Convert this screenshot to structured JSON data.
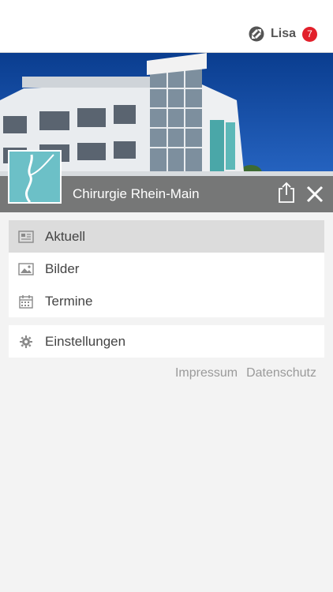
{
  "header": {
    "user_name": "Lisa",
    "notification_count": "7",
    "brand_color": "#e2202b"
  },
  "hero": {
    "title": "Chirurgie Rhein-Main",
    "logo_color": "#6cc0c7"
  },
  "menu": {
    "items": [
      {
        "label": "Aktuell",
        "icon": "newspaper-icon",
        "active": true
      },
      {
        "label": "Bilder",
        "icon": "image-icon",
        "active": false
      },
      {
        "label": "Termine",
        "icon": "calendar-icon",
        "active": false
      }
    ],
    "settings": {
      "label": "Einstellungen",
      "icon": "gear-icon"
    }
  },
  "footer": {
    "impressum": "Impressum",
    "datenschutz": "Datenschutz"
  }
}
